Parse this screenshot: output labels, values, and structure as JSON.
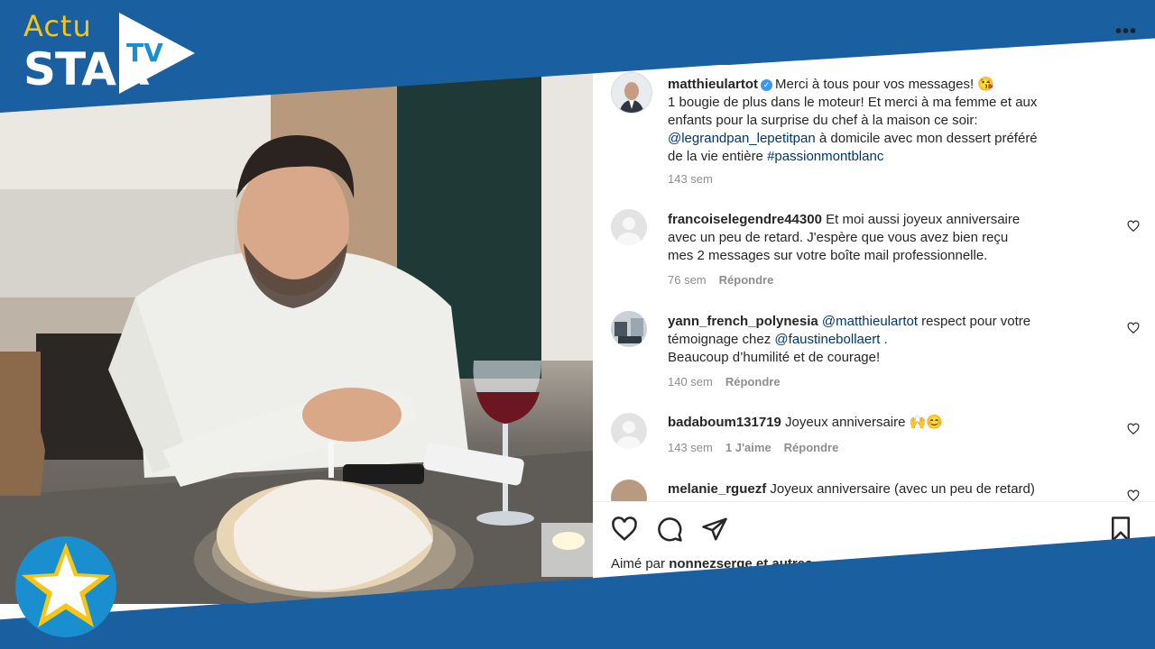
{
  "logo": {
    "line1": "Actu",
    "line2": "STAR",
    "line3": "TV"
  },
  "post": {
    "author": "matthieulartot",
    "caption_1": "Merci à tous pour vos messages! 😘",
    "caption_2": "1 bougie de plus dans le moteur! Et merci à ma femme et aux",
    "caption_3": "enfants pour la surprise du chef à la maison ce soir:",
    "caption_mention": "@legrandpan_lepetitpan",
    "caption_4": " à domicile avec mon dessert préféré",
    "caption_5": "de la vie entière ",
    "caption_hashtag": "#passionmontblanc",
    "time": "143 sem"
  },
  "comments": [
    {
      "user": "francoiselegendre44300",
      "text_1": " Et moi aussi joyeux anniversaire",
      "text_2": "avec un peu de retard. J'espère que vous avez bien reçu",
      "text_3": "mes 2 messages sur votre boîte mail professionnelle.",
      "time": "76 sem",
      "reply": "Répondre"
    },
    {
      "user": "yann_french_polynesia",
      "mention_1": "@matthieulartot",
      "text_1": " respect pour votre",
      "text_2": "témoignage chez ",
      "mention_2": "@faustinebollaert",
      "text_3": " .",
      "text_4": "Beaucoup d’humilité et de courage!",
      "time": "140 sem",
      "reply": "Répondre"
    },
    {
      "user": "badaboum131719",
      "text_1": " Joyeux anniversaire 🙌😊",
      "time": "143 sem",
      "likes": "1 J'aime",
      "reply": "Répondre"
    },
    {
      "user": "melanie_rguezf",
      "text_1": " Joyeux anniversaire (avec un peu de retard)"
    }
  ],
  "liked_by": {
    "prefix": "Aimé par ",
    "user": "nonnezserge",
    "suffix": " et autres"
  },
  "colors": {
    "frame_blue": "#1a5fa0",
    "logo_yellow": "#f5c518",
    "link": "#00376b"
  },
  "icons": [
    "more-icon",
    "heart-icon",
    "comment-icon",
    "share-icon",
    "bookmark-icon",
    "star-badge-icon"
  ]
}
